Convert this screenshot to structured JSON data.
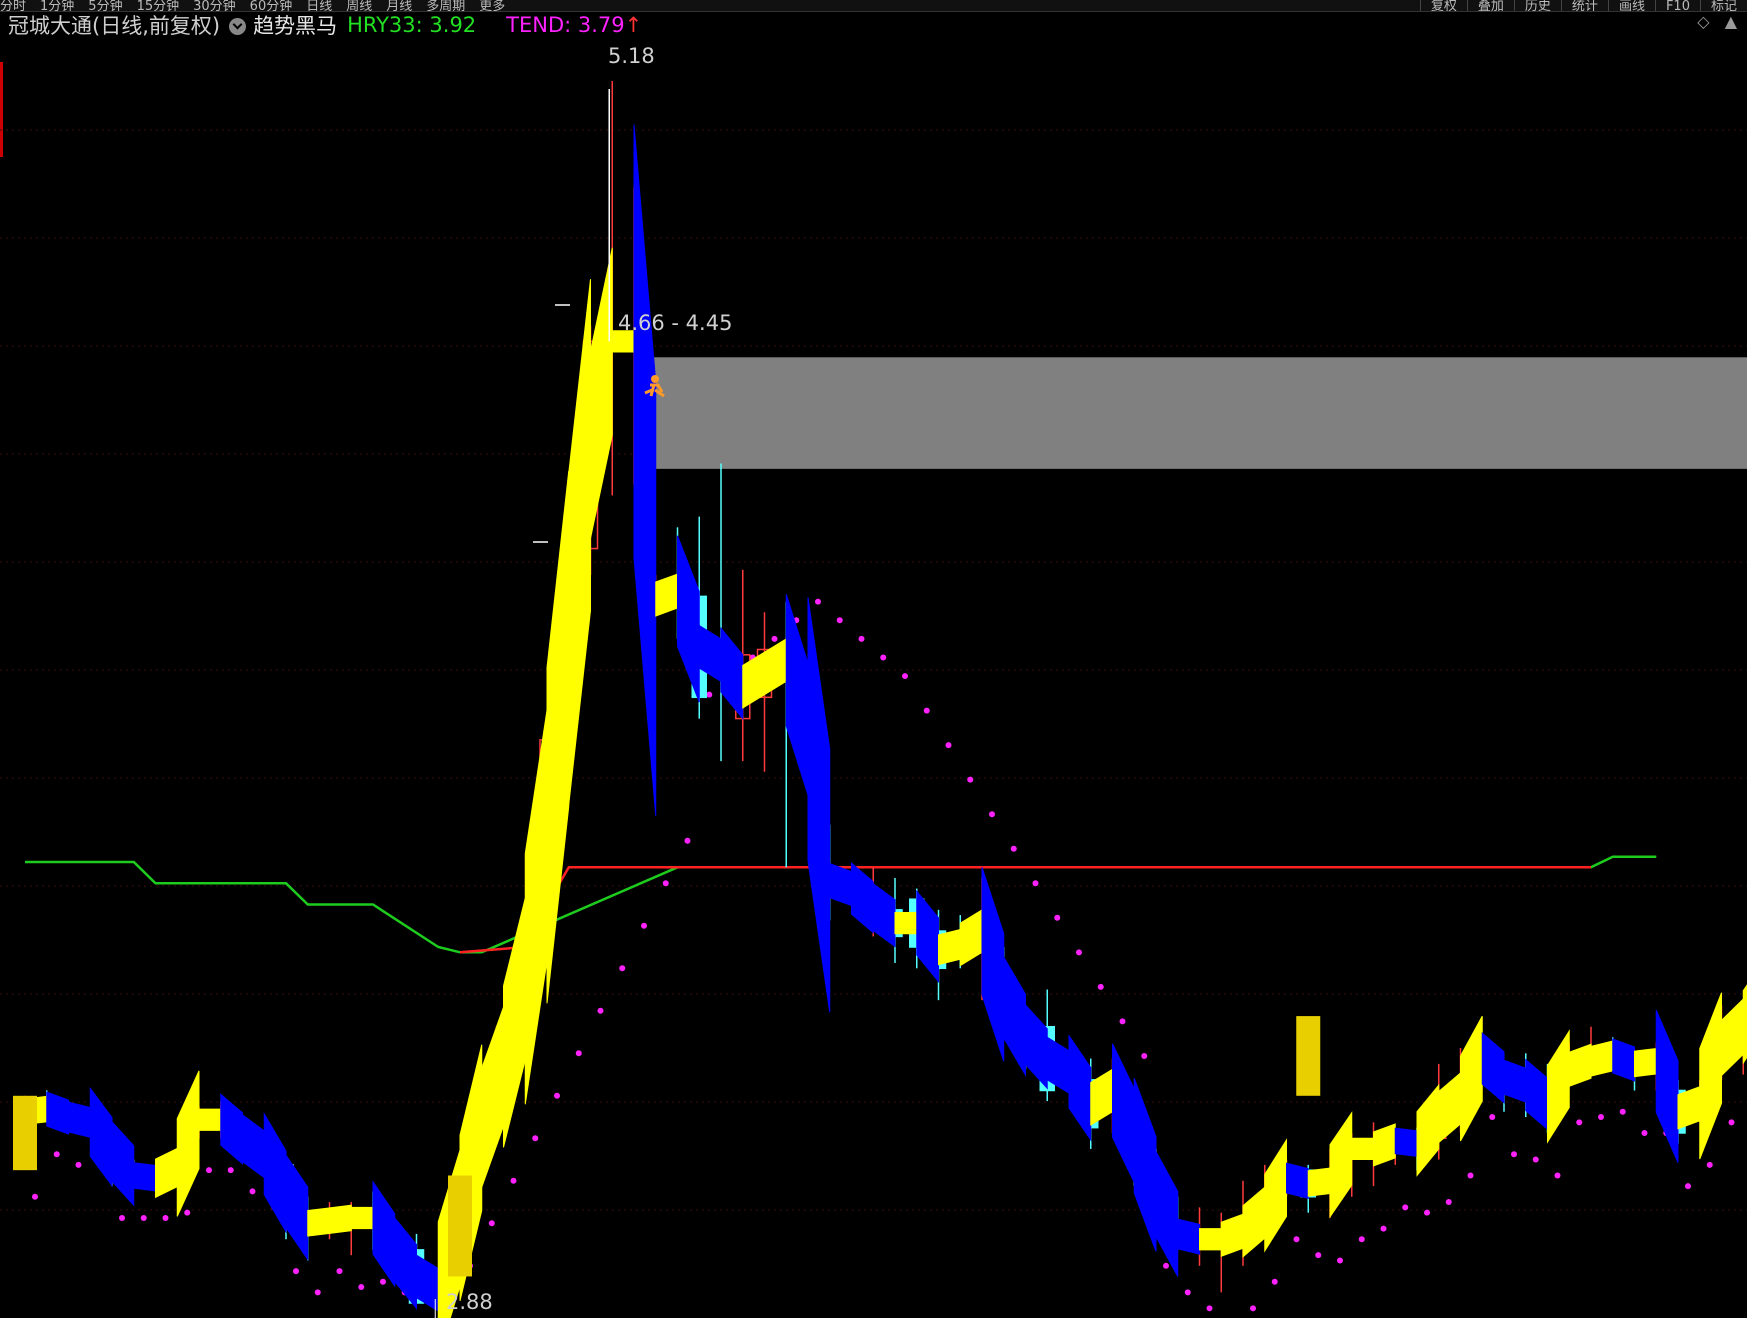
{
  "toolbar": {
    "left_items": [
      "分时",
      "1分钟",
      "5分钟",
      "15分钟",
      "30分钟",
      "60分钟",
      "日线",
      "周线",
      "月线",
      "多周期",
      "更多"
    ],
    "right_items": [
      "复权",
      "叠加",
      "历史",
      "统计",
      "画线",
      "F10",
      "标记"
    ]
  },
  "header": {
    "stock_name": "冠城大通(日线,前复权)",
    "indicator_name": "趋势黑马",
    "hry_label": "HRY33: 3.92",
    "tend_label": "TEND: 3.79",
    "tend_arrow": "↑"
  },
  "corner_tools": {
    "diamond": "◇",
    "scroll_up": "▲"
  },
  "annotations": {
    "high_label": "5.18",
    "low_label": "2.88",
    "zone_label": "4.66 - 4.45"
  },
  "colors": {
    "background": "#000000",
    "up_candle": "#ff3b3b",
    "down_candle": "#54ffff",
    "ribbon_up": "#ffff00",
    "ribbon_down": "#0000ff",
    "green_line": "#1ecc1e",
    "red_line": "#ff2222",
    "magenta_dots": "#ff22ff",
    "zone": "#808080",
    "gold_block": "#e8d000"
  },
  "chart_data": {
    "type": "candlestick",
    "title": "冠城大通(日线,前复权)",
    "y_range": [
      2.8,
      5.3
    ],
    "price_high": 5.18,
    "price_low": 2.88,
    "resistance_zone": [
      4.45,
      4.66
    ],
    "hry33": 3.92,
    "tend": 3.79,
    "candles": [
      [
        3.23,
        3.25,
        3.14,
        3.27
      ],
      [
        3.25,
        3.24,
        3.22,
        3.28
      ],
      [
        3.24,
        3.22,
        3.2,
        3.26
      ],
      [
        3.22,
        3.22,
        3.2,
        3.24
      ],
      [
        3.2,
        3.13,
        3.1,
        3.21
      ],
      [
        3.13,
        3.11,
        3.1,
        3.15
      ],
      [
        3.11,
        3.12,
        3.1,
        3.14
      ],
      [
        3.13,
        3.14,
        3.11,
        3.16
      ],
      [
        3.22,
        3.23,
        3.19,
        3.25
      ],
      [
        3.22,
        3.23,
        3.19,
        3.26
      ],
      [
        3.2,
        3.18,
        3.15,
        3.22
      ],
      [
        3.17,
        3.15,
        3.12,
        3.18
      ],
      [
        3.14,
        3.04,
        3.0,
        3.15
      ],
      [
        3.04,
        3.02,
        2.96,
        3.08
      ],
      [
        3.03,
        3.04,
        3.0,
        3.07
      ],
      [
        3.03,
        3.05,
        2.97,
        3.07
      ],
      [
        3.05,
        3.03,
        2.98,
        3.09
      ],
      [
        2.98,
        2.98,
        2.96,
        3.02
      ],
      [
        2.98,
        2.88,
        2.89,
        3.01
      ],
      [
        2.88,
        2.93,
        2.88,
        2.94
      ],
      [
        3.1,
        2.98,
        2.98,
        3.12
      ],
      [
        3.17,
        3.25,
        3.12,
        3.32
      ],
      [
        3.25,
        3.4,
        3.22,
        3.42
      ],
      [
        3.4,
        3.58,
        3.35,
        3.62
      ],
      [
        3.58,
        3.94,
        3.55,
        3.96
      ],
      [
        3.96,
        4.3,
        3.95,
        4.35
      ],
      [
        4.3,
        4.69,
        4.25,
        4.72
      ],
      [
        4.69,
        4.69,
        4.4,
        5.18
      ],
      [
        4.69,
        4.69,
        4.42,
        4.98
      ],
      [
        4.2,
        4.21,
        4.21,
        4.25
      ],
      [
        4.23,
        4.21,
        4.13,
        4.34
      ],
      [
        4.21,
        4.02,
        3.98,
        4.36
      ],
      [
        4.12,
        4.06,
        3.9,
        4.46
      ],
      [
        3.98,
        4.1,
        3.9,
        4.26
      ],
      [
        4.02,
        4.11,
        3.88,
        4.18
      ],
      [
        4.1,
        4.08,
        3.7,
        4.2
      ],
      [
        3.96,
        3.96,
        3.84,
        3.99
      ],
      [
        3.7,
        3.65,
        3.6,
        3.78
      ],
      [
        3.66,
        3.66,
        3.66,
        3.66
      ],
      [
        3.6,
        3.65,
        3.57,
        3.7
      ],
      [
        3.62,
        3.57,
        3.52,
        3.68
      ],
      [
        3.64,
        3.55,
        3.51,
        3.66
      ],
      [
        3.58,
        3.51,
        3.45,
        3.62
      ],
      [
        3.57,
        3.54,
        3.51,
        3.61
      ],
      [
        3.56,
        3.6,
        3.45,
        3.68
      ],
      [
        3.48,
        3.43,
        3.38,
        3.55
      ],
      [
        3.41,
        3.36,
        3.32,
        3.44
      ],
      [
        3.4,
        3.28,
        3.26,
        3.47
      ],
      [
        3.33,
        3.3,
        3.3,
        3.35
      ],
      [
        3.3,
        3.21,
        3.17,
        3.34
      ],
      [
        3.25,
        3.31,
        3.2,
        3.34
      ],
      [
        3.24,
        3.15,
        3.1,
        3.26
      ],
      [
        3.13,
        3.04,
        3.03,
        3.17
      ],
      [
        3.03,
        2.99,
        2.98,
        3.08
      ],
      [
        3.0,
        3.0,
        2.95,
        3.06
      ],
      [
        3.0,
        3.0,
        2.9,
        3.05
      ],
      [
        3.0,
        3.03,
        2.95,
        3.11
      ],
      [
        3.04,
        3.06,
        3.0,
        3.14
      ],
      [
        3.1,
        3.13,
        3.08,
        3.15
      ],
      [
        3.13,
        3.08,
        3.05,
        3.14
      ],
      [
        3.1,
        3.12,
        3.04,
        3.17
      ],
      [
        3.16,
        3.18,
        3.08,
        3.2
      ],
      [
        3.16,
        3.18,
        3.1,
        3.22
      ],
      [
        3.18,
        3.19,
        3.14,
        3.21
      ],
      [
        3.19,
        3.17,
        3.13,
        3.21
      ],
      [
        3.19,
        3.27,
        3.15,
        3.33
      ],
      [
        3.25,
        3.28,
        3.2,
        3.36
      ],
      [
        3.35,
        3.33,
        3.31,
        3.37
      ],
      [
        3.31,
        3.3,
        3.24,
        3.33
      ],
      [
        3.3,
        3.28,
        3.23,
        3.35
      ],
      [
        3.26,
        3.25,
        3.2,
        3.33
      ],
      [
        3.31,
        3.33,
        3.3,
        3.37
      ],
      [
        3.33,
        3.34,
        3.31,
        3.4
      ],
      [
        3.35,
        3.34,
        3.32,
        3.38
      ],
      [
        3.34,
        3.32,
        3.28,
        3.35
      ],
      [
        3.32,
        3.35,
        3.28,
        3.37
      ],
      [
        3.28,
        3.2,
        3.18,
        3.3
      ],
      [
        3.24,
        3.27,
        3.22,
        3.3
      ],
      [
        3.34,
        3.38,
        3.3,
        3.44
      ],
      [
        3.39,
        3.41,
        3.31,
        3.43
      ],
      [
        3.45,
        3.47,
        3.4,
        3.5
      ],
      [
        3.43,
        3.4,
        3.35,
        3.45
      ],
      [
        3.58,
        3.66,
        3.5,
        3.78
      ],
      [
        3.87,
        3.98,
        3.57,
        4.38
      ],
      [
        3.85,
        4.04,
        3.82,
        4.11
      ],
      [
        4.08,
        4.19,
        4.07,
        4.29
      ],
      [
        4.2,
        4.04,
        3.94,
        4.3
      ],
      [
        3.92,
        3.87,
        3.85,
        4.0
      ],
      [
        3.74,
        3.76,
        3.64,
        3.8
      ],
      [
        3.73,
        3.68,
        3.66,
        3.76
      ],
      [
        3.7,
        3.7,
        3.65,
        3.74
      ],
      [
        3.75,
        3.82,
        3.66,
        3.89
      ]
    ],
    "green_line": [
      [
        0,
        3.71
      ],
      [
        5,
        3.71
      ],
      [
        6,
        3.67
      ],
      [
        12,
        3.67
      ],
      [
        13,
        3.63
      ],
      [
        16,
        3.63
      ],
      [
        19,
        3.55
      ],
      [
        20,
        3.54
      ],
      [
        21,
        3.54
      ],
      [
        30,
        3.7
      ],
      [
        69,
        3.7
      ],
      [
        72,
        3.7
      ],
      [
        73,
        3.72
      ],
      [
        75,
        3.72
      ]
    ],
    "red_line": [
      [
        20,
        3.54
      ],
      [
        23,
        3.55
      ],
      [
        24,
        3.63
      ],
      [
        25,
        3.7
      ],
      [
        31,
        3.7
      ],
      [
        68,
        3.7
      ],
      [
        72,
        3.7
      ]
    ]
  }
}
